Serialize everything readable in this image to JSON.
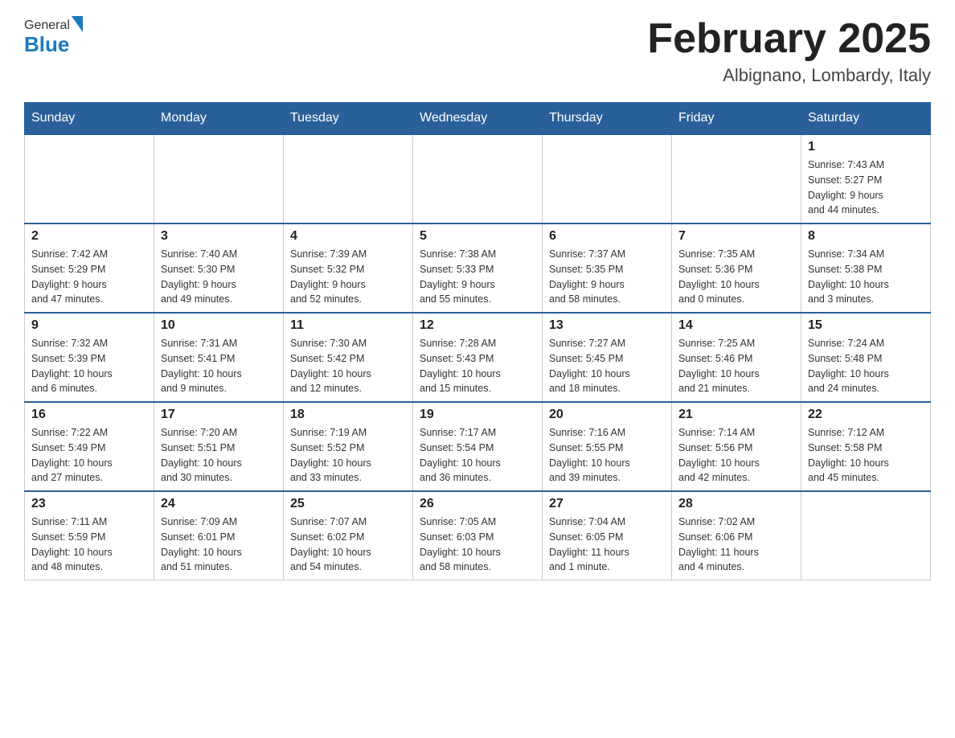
{
  "header": {
    "logo_general": "General",
    "logo_blue": "Blue",
    "month_year": "February 2025",
    "location": "Albignano, Lombardy, Italy"
  },
  "weekdays": [
    "Sunday",
    "Monday",
    "Tuesday",
    "Wednesday",
    "Thursday",
    "Friday",
    "Saturday"
  ],
  "weeks": [
    [
      {
        "day": "",
        "info": ""
      },
      {
        "day": "",
        "info": ""
      },
      {
        "day": "",
        "info": ""
      },
      {
        "day": "",
        "info": ""
      },
      {
        "day": "",
        "info": ""
      },
      {
        "day": "",
        "info": ""
      },
      {
        "day": "1",
        "info": "Sunrise: 7:43 AM\nSunset: 5:27 PM\nDaylight: 9 hours\nand 44 minutes."
      }
    ],
    [
      {
        "day": "2",
        "info": "Sunrise: 7:42 AM\nSunset: 5:29 PM\nDaylight: 9 hours\nand 47 minutes."
      },
      {
        "day": "3",
        "info": "Sunrise: 7:40 AM\nSunset: 5:30 PM\nDaylight: 9 hours\nand 49 minutes."
      },
      {
        "day": "4",
        "info": "Sunrise: 7:39 AM\nSunset: 5:32 PM\nDaylight: 9 hours\nand 52 minutes."
      },
      {
        "day": "5",
        "info": "Sunrise: 7:38 AM\nSunset: 5:33 PM\nDaylight: 9 hours\nand 55 minutes."
      },
      {
        "day": "6",
        "info": "Sunrise: 7:37 AM\nSunset: 5:35 PM\nDaylight: 9 hours\nand 58 minutes."
      },
      {
        "day": "7",
        "info": "Sunrise: 7:35 AM\nSunset: 5:36 PM\nDaylight: 10 hours\nand 0 minutes."
      },
      {
        "day": "8",
        "info": "Sunrise: 7:34 AM\nSunset: 5:38 PM\nDaylight: 10 hours\nand 3 minutes."
      }
    ],
    [
      {
        "day": "9",
        "info": "Sunrise: 7:32 AM\nSunset: 5:39 PM\nDaylight: 10 hours\nand 6 minutes."
      },
      {
        "day": "10",
        "info": "Sunrise: 7:31 AM\nSunset: 5:41 PM\nDaylight: 10 hours\nand 9 minutes."
      },
      {
        "day": "11",
        "info": "Sunrise: 7:30 AM\nSunset: 5:42 PM\nDaylight: 10 hours\nand 12 minutes."
      },
      {
        "day": "12",
        "info": "Sunrise: 7:28 AM\nSunset: 5:43 PM\nDaylight: 10 hours\nand 15 minutes."
      },
      {
        "day": "13",
        "info": "Sunrise: 7:27 AM\nSunset: 5:45 PM\nDaylight: 10 hours\nand 18 minutes."
      },
      {
        "day": "14",
        "info": "Sunrise: 7:25 AM\nSunset: 5:46 PM\nDaylight: 10 hours\nand 21 minutes."
      },
      {
        "day": "15",
        "info": "Sunrise: 7:24 AM\nSunset: 5:48 PM\nDaylight: 10 hours\nand 24 minutes."
      }
    ],
    [
      {
        "day": "16",
        "info": "Sunrise: 7:22 AM\nSunset: 5:49 PM\nDaylight: 10 hours\nand 27 minutes."
      },
      {
        "day": "17",
        "info": "Sunrise: 7:20 AM\nSunset: 5:51 PM\nDaylight: 10 hours\nand 30 minutes."
      },
      {
        "day": "18",
        "info": "Sunrise: 7:19 AM\nSunset: 5:52 PM\nDaylight: 10 hours\nand 33 minutes."
      },
      {
        "day": "19",
        "info": "Sunrise: 7:17 AM\nSunset: 5:54 PM\nDaylight: 10 hours\nand 36 minutes."
      },
      {
        "day": "20",
        "info": "Sunrise: 7:16 AM\nSunset: 5:55 PM\nDaylight: 10 hours\nand 39 minutes."
      },
      {
        "day": "21",
        "info": "Sunrise: 7:14 AM\nSunset: 5:56 PM\nDaylight: 10 hours\nand 42 minutes."
      },
      {
        "day": "22",
        "info": "Sunrise: 7:12 AM\nSunset: 5:58 PM\nDaylight: 10 hours\nand 45 minutes."
      }
    ],
    [
      {
        "day": "23",
        "info": "Sunrise: 7:11 AM\nSunset: 5:59 PM\nDaylight: 10 hours\nand 48 minutes."
      },
      {
        "day": "24",
        "info": "Sunrise: 7:09 AM\nSunset: 6:01 PM\nDaylight: 10 hours\nand 51 minutes."
      },
      {
        "day": "25",
        "info": "Sunrise: 7:07 AM\nSunset: 6:02 PM\nDaylight: 10 hours\nand 54 minutes."
      },
      {
        "day": "26",
        "info": "Sunrise: 7:05 AM\nSunset: 6:03 PM\nDaylight: 10 hours\nand 58 minutes."
      },
      {
        "day": "27",
        "info": "Sunrise: 7:04 AM\nSunset: 6:05 PM\nDaylight: 11 hours\nand 1 minute."
      },
      {
        "day": "28",
        "info": "Sunrise: 7:02 AM\nSunset: 6:06 PM\nDaylight: 11 hours\nand 4 minutes."
      },
      {
        "day": "",
        "info": ""
      }
    ]
  ]
}
